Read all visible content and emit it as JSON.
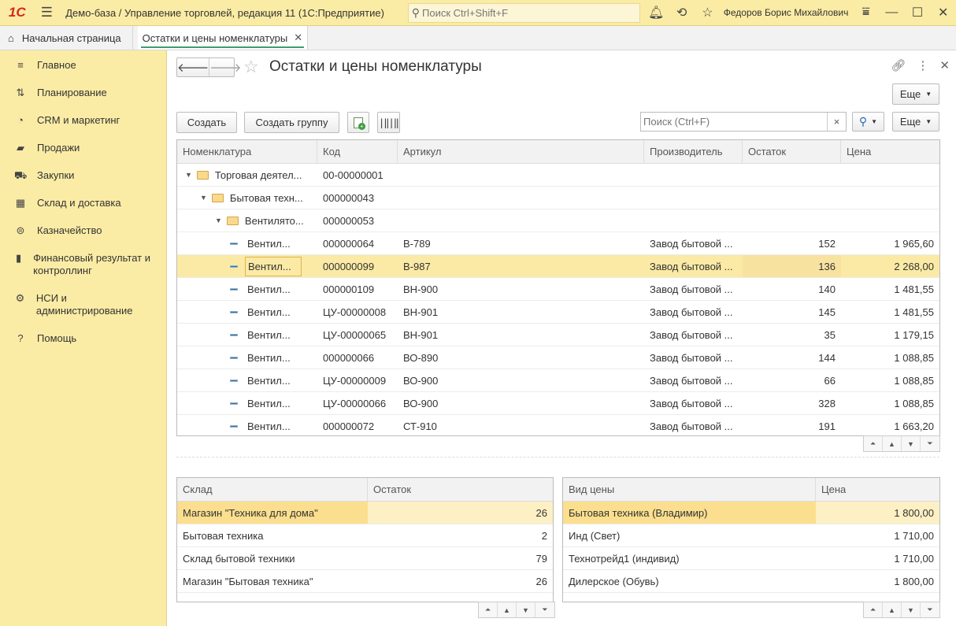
{
  "titlebar": {
    "logo": "1С",
    "title": "Демо-база / Управление торговлей, редакция 11  (1С:Предприятие)",
    "search_placeholder": "Поиск Ctrl+Shift+F",
    "user": "Федоров Борис Михайлович"
  },
  "tabs": {
    "home": "Начальная страница",
    "active": "Остатки и цены номенклатуры"
  },
  "sidebar": {
    "items": [
      {
        "icon": "≡",
        "label": "Главное"
      },
      {
        "icon": "⇅",
        "label": "Планирование"
      },
      {
        "icon": "◔",
        "label": "CRM и маркетинг"
      },
      {
        "icon": "▰",
        "label": "Продажи"
      },
      {
        "icon": "⛟",
        "label": "Закупки"
      },
      {
        "icon": "▦",
        "label": "Склад и доставка"
      },
      {
        "icon": "⊜",
        "label": "Казначейство"
      },
      {
        "icon": "▮",
        "label": "Финансовый результат и контроллинг"
      },
      {
        "icon": "⚙",
        "label": "НСИ и администрирование"
      },
      {
        "icon": "?",
        "label": "Помощь"
      }
    ]
  },
  "form": {
    "title": "Остатки и цены номенклатуры",
    "more_label": "Еще",
    "create_label": "Создать",
    "create_group_label": "Создать группу",
    "filter_placeholder": "Поиск (Ctrl+F)",
    "filter_clear": "×"
  },
  "items_table": {
    "columns": [
      "Номенклатура",
      "Код",
      "Артикул",
      "Производитель",
      "Остаток",
      "Цена"
    ],
    "rows": [
      {
        "level": 0,
        "type": "group",
        "name": "Торговая деятел...",
        "code": "00-00000001",
        "article": "",
        "maker": "",
        "stock": "",
        "price": ""
      },
      {
        "level": 1,
        "type": "group",
        "name": "Бытовая техн...",
        "code": "000000043",
        "article": "",
        "maker": "",
        "stock": "",
        "price": ""
      },
      {
        "level": 2,
        "type": "group",
        "name": "Вентилято...",
        "code": "000000053",
        "article": "",
        "maker": "",
        "stock": "",
        "price": ""
      },
      {
        "level": 3,
        "type": "item",
        "name": "Вентил...",
        "code": "000000064",
        "article": "В-789",
        "maker": "Завод бытовой ...",
        "stock": "152",
        "price": "1 965,60"
      },
      {
        "level": 3,
        "type": "item",
        "name": "Вентил...",
        "code": "000000099",
        "article": "В-987",
        "maker": "Завод бытовой ...",
        "stock": "136",
        "price": "2 268,00",
        "selected": true
      },
      {
        "level": 3,
        "type": "item",
        "name": "Вентил...",
        "code": "000000109",
        "article": "ВН-900",
        "maker": "Завод бытовой ...",
        "stock": "140",
        "price": "1 481,55"
      },
      {
        "level": 3,
        "type": "item",
        "name": "Вентил...",
        "code": "ЦУ-00000008",
        "article": "ВН-901",
        "maker": "Завод бытовой ...",
        "stock": "145",
        "price": "1 481,55"
      },
      {
        "level": 3,
        "type": "item",
        "name": "Вентил...",
        "code": "ЦУ-00000065",
        "article": "ВН-901",
        "maker": "Завод бытовой ...",
        "stock": "35",
        "price": "1 179,15"
      },
      {
        "level": 3,
        "type": "item",
        "name": "Вентил...",
        "code": "000000066",
        "article": "ВО-890",
        "maker": "Завод бытовой ...",
        "stock": "144",
        "price": "1 088,85"
      },
      {
        "level": 3,
        "type": "item",
        "name": "Вентил...",
        "code": "ЦУ-00000009",
        "article": "ВО-900",
        "maker": "Завод бытовой ...",
        "stock": "66",
        "price": "1 088,85"
      },
      {
        "level": 3,
        "type": "item",
        "name": "Вентил...",
        "code": "ЦУ-00000066",
        "article": "ВО-900",
        "maker": "Завод бытовой ...",
        "stock": "328",
        "price": "1 088,85"
      },
      {
        "level": 3,
        "type": "item",
        "name": "Вентил...",
        "code": "000000072",
        "article": "СТ-910",
        "maker": "Завод бытовой ...",
        "stock": "191",
        "price": "1 663,20"
      }
    ]
  },
  "stock_table": {
    "columns": [
      "Склад",
      "Остаток"
    ],
    "rows": [
      {
        "name": "Магазин \"Техника для дома\"",
        "value": "26",
        "selected": true
      },
      {
        "name": "Бытовая техника",
        "value": "2"
      },
      {
        "name": "Склад бытовой техники",
        "value": "79"
      },
      {
        "name": "Магазин \"Бытовая техника\"",
        "value": "26"
      }
    ]
  },
  "price_table": {
    "columns": [
      "Вид цены",
      "Цена"
    ],
    "rows": [
      {
        "name": "Бытовая техника (Владимир)",
        "value": "1 800,00",
        "selected": true
      },
      {
        "name": "Инд (Свет)",
        "value": "1 710,00"
      },
      {
        "name": "Технотрейд1 (индивид)",
        "value": "1 710,00"
      },
      {
        "name": "Дилерское (Обувь)",
        "value": "1 800,00"
      }
    ]
  }
}
